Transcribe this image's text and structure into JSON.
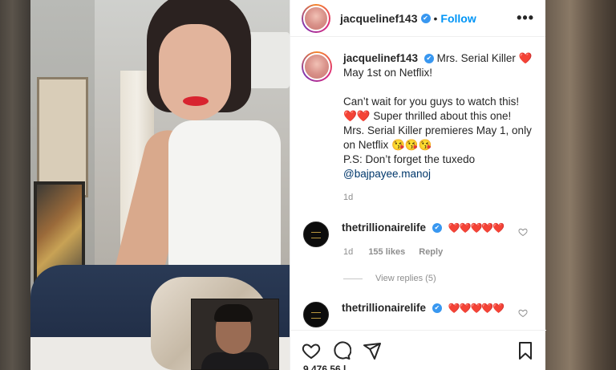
{
  "post": {
    "author": "jacquelinef143",
    "follow_label": "Follow",
    "separator": "•",
    "more_label": "•••",
    "verified_mark": "✔",
    "caption": {
      "username": "jacquelinef143",
      "text": "Mrs. Serial Killer ❤️\nMay 1st on Netflix!\n\nCan’t wait for you guys to watch this! ❤️❤️ Super thrilled about this one!\nMrs. Serial Killer premieres May 1, only on Netflix 😘😘😘\nP.S: Don’t forget the tuxedo",
      "mention": "@bajpayee.manoj",
      "time": "1d"
    },
    "comments": [
      {
        "username": "thetrillionairelife",
        "text": "❤️❤️❤️❤️❤️",
        "time": "1d",
        "likes": "155 likes",
        "reply_label": "Reply"
      },
      {
        "username": "thetrillionairelife",
        "text": "❤️❤️❤️❤️❤️"
      }
    ],
    "view_replies": "View replies (5)",
    "likes_peek": "9,476,56 l... "
  },
  "icons": {
    "like": "heart-icon",
    "comment": "comment-icon",
    "share": "share-icon",
    "save": "bookmark-icon",
    "comment_like": "heart-outline-icon",
    "verified": "verified-badge-icon",
    "more": "more-options-icon"
  },
  "colors": {
    "follow": "#0095f6",
    "verified": "#3897f0",
    "heart": "#e0243a",
    "mention": "#00376b",
    "muted": "#8e8e8e"
  }
}
